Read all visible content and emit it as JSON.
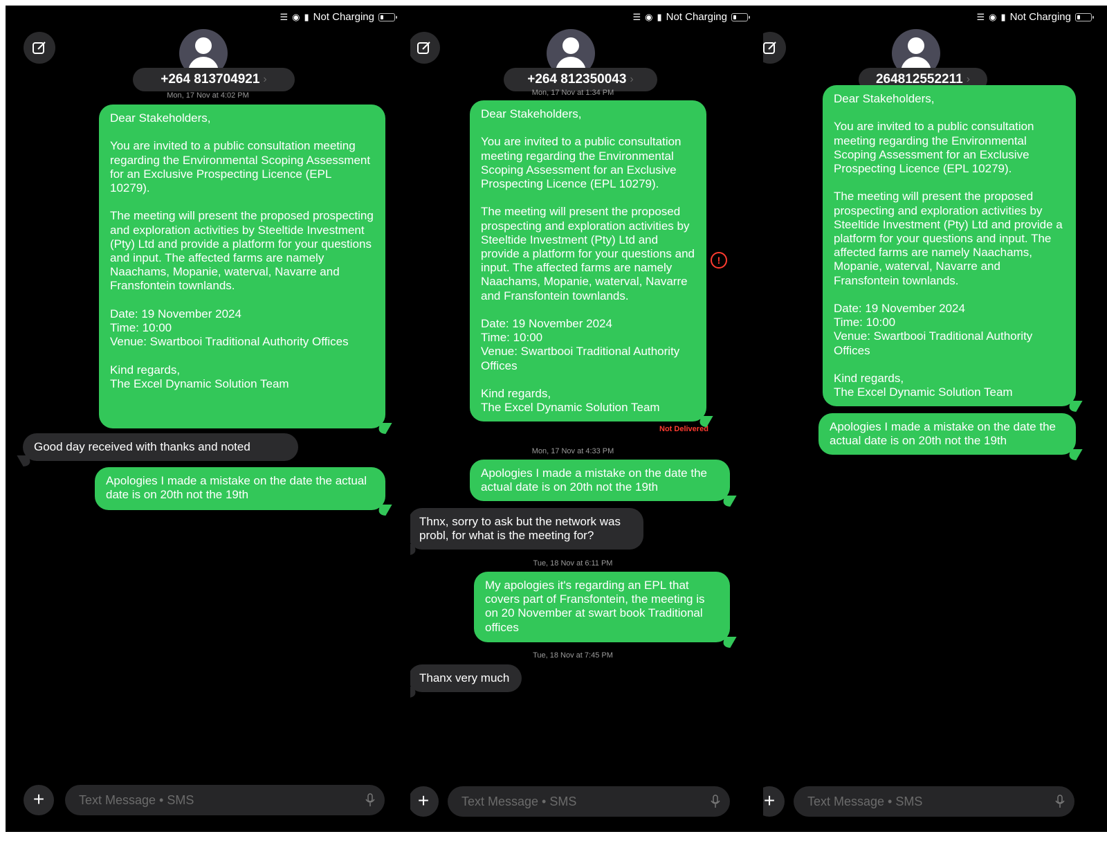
{
  "status": {
    "charging": "Not Charging"
  },
  "invitation": "Dear Stakeholders,\n\nYou are invited to a public consultation meeting regarding the Environmental Scoping Assessment for an Exclusive Prospecting Licence (EPL 10279).\n\nThe meeting will present the proposed prospecting and exploration activities by Steeltide Investment (Pty) Ltd and provide a platform for your questions and input. The affected farms are namely Naachams, Mopanie, waterval, Navarre and Fransfontein townlands.\n\nDate: 19 November 2024\nTime: 10:00\nVenue: Swartbooi Traditional Authority Offices\n\nKind regards,\nThe Excel Dynamic Solution Team",
  "correction": "Apologies I made a mistake on the date the actual date is on 20th not the 19th",
  "composer": {
    "placeholder": "Text Message • SMS",
    "plus": "+"
  },
  "panels": [
    {
      "contact": "+264 813704921",
      "timestamp": "Mon, 17 Nov at 4:02 PM",
      "reply": "Good day received with thanks and noted"
    },
    {
      "contact": "+264 812350043",
      "timestamp": "Mon, 17 Nov at 1:34 PM",
      "not_delivered": "Not Delivered",
      "error_icon": "!",
      "timestamp2": "Mon, 17 Nov at 4:33 PM",
      "reply1": "Thnx, sorry to ask but the network was probl, for what is the meeting for?",
      "timestamp3": "Tue, 18 Nov at 6:11 PM",
      "sent2": "My apologies it's regarding an EPL that covers part of Fransfontein, the meeting is on 20 November at swart book Traditional offices",
      "timestamp4": "Tue, 18 Nov at 7:45 PM",
      "reply2": "Thanx very much"
    },
    {
      "contact": "264812552211"
    }
  ]
}
